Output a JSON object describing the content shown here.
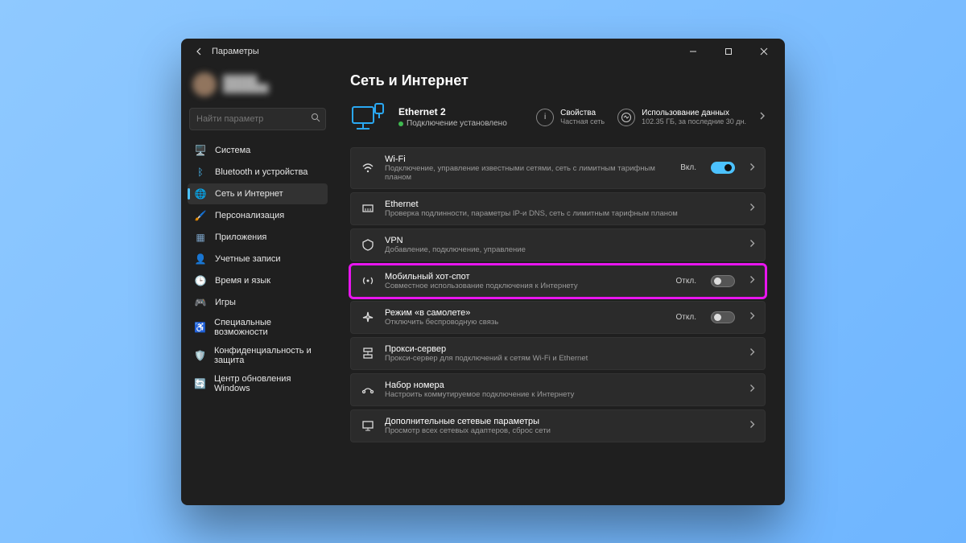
{
  "titlebar": {
    "title": "Параметры"
  },
  "search": {
    "placeholder": "Найти параметр"
  },
  "nav": {
    "items": [
      {
        "label": "Система",
        "icon": "🖥️",
        "color": "#4cc2ff"
      },
      {
        "label": "Bluetooth и устройства",
        "icon": "ᛒ",
        "color": "#4cc2ff"
      },
      {
        "label": "Сеть и Интернет",
        "icon": "🌐",
        "color": "#4cc2ff",
        "active": true
      },
      {
        "label": "Персонализация",
        "icon": "🖌️",
        "color": "#e07b3c"
      },
      {
        "label": "Приложения",
        "icon": "▦",
        "color": "#7aa0c4"
      },
      {
        "label": "Учетные записи",
        "icon": "👤",
        "color": "#60c689"
      },
      {
        "label": "Время и язык",
        "icon": "🕒",
        "color": "#5dc0d8"
      },
      {
        "label": "Игры",
        "icon": "🎮",
        "color": "#8bd17c"
      },
      {
        "label": "Специальные возможности",
        "icon": "♿",
        "color": "#6fa8dc"
      },
      {
        "label": "Конфиденциальность и защита",
        "icon": "🛡️",
        "color": "#c9a86a"
      },
      {
        "label": "Центр обновления Windows",
        "icon": "🔄",
        "color": "#2ea8e0"
      }
    ]
  },
  "page": {
    "title": "Сеть и Интернет",
    "hero": {
      "name": "Ethernet 2",
      "status": "Подключение установлено"
    },
    "properties": {
      "title": "Свойства",
      "sub": "Частная сеть"
    },
    "data_usage": {
      "title": "Использование данных",
      "sub": "102.35 ГБ, за последние 30 дн."
    }
  },
  "cards": [
    {
      "icon": "wifi",
      "title": "Wi-Fi",
      "sub": "Подключение, управление известными сетями, сеть с лимитным тарифным планом",
      "state": "Вкл.",
      "toggle": "on"
    },
    {
      "icon": "ethernet",
      "title": "Ethernet",
      "sub": "Проверка подлинности, параметры IP-и DNS, сеть с лимитным тарифным планом"
    },
    {
      "icon": "vpn",
      "title": "VPN",
      "sub": "Добавление, подключение, управление"
    },
    {
      "icon": "hotspot",
      "title": "Мобильный хот-спот",
      "sub": "Совместное использование подключения к Интернету",
      "state": "Откл.",
      "toggle": "off",
      "highlight": true
    },
    {
      "icon": "airplane",
      "title": "Режим «в самолете»",
      "sub": "Отключить беспроводную связь",
      "state": "Откл.",
      "toggle": "off"
    },
    {
      "icon": "proxy",
      "title": "Прокси-сервер",
      "sub": "Прокси-сервер для подключений к сетям Wi-Fi и Ethernet"
    },
    {
      "icon": "dialup",
      "title": "Набор номера",
      "sub": "Настроить коммутируемое подключение к Интернету"
    },
    {
      "icon": "advanced",
      "title": "Дополнительные сетевые параметры",
      "sub": "Просмотр всех сетевых адаптеров, сброс сети"
    }
  ]
}
